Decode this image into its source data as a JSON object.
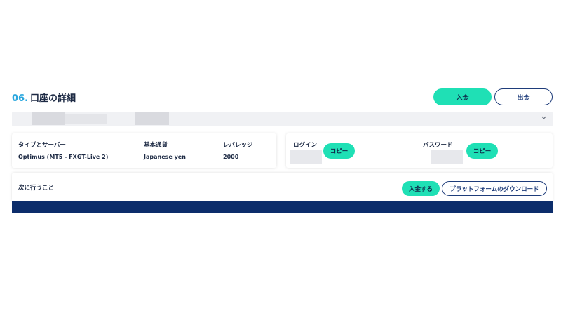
{
  "header": {
    "section_number": "06.",
    "section_title": "口座の詳細",
    "deposit_label": "入金",
    "withdraw_label": "出金"
  },
  "account_selector": {
    "chevron_icon": "chevron-down-icon"
  },
  "account_info": {
    "server_label": "タイプとサーバー",
    "server_value": "Optimus (MT5 - FXGT-Live 2)",
    "currency_label": "基本通貨",
    "currency_value": "Japanese yen",
    "leverage_label": "レバレッジ",
    "leverage_value": "2000"
  },
  "credentials": {
    "login_label": "ログイン",
    "login_copy_label": "コピー",
    "password_label": "パスワード",
    "password_copy_label": "コピー"
  },
  "next_steps": {
    "label": "次に行うこと",
    "deposit_label": "入金する",
    "download_label": "プラットフォームのダウンロード"
  },
  "colors": {
    "accent": "#1fe0b5",
    "navy": "#0c2d6b",
    "section_number": "#2aa7de",
    "text": "#1d2a44"
  }
}
